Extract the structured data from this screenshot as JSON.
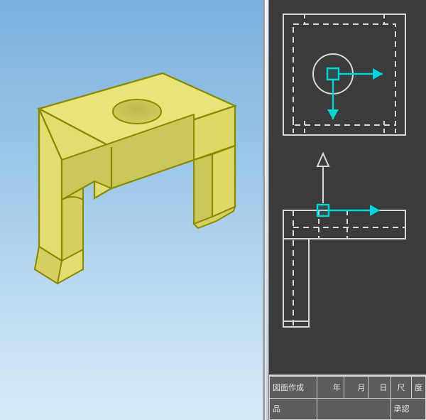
{
  "viewport3d": {
    "background_top": "#79b1df",
    "background_bottom": "#d8eaf8",
    "part_color_fill": "#e8e47a",
    "part_color_edge": "#8a8a00",
    "part_color_shade": "#d4cf60"
  },
  "viewport2d": {
    "background": "#3b3b3b",
    "line_color": "#d8d8d8",
    "accent_arrow_color": "#00d8d8",
    "accent_square_color": "#52c8c8"
  },
  "title_block": {
    "row1": {
      "cell1": "図面作成",
      "cell2": "年",
      "cell3": "月",
      "cell4": "日",
      "cell5": "尺",
      "cell6": "度"
    },
    "row2": {
      "cell1": "品",
      "cell2": "",
      "cell3": "承認"
    }
  }
}
